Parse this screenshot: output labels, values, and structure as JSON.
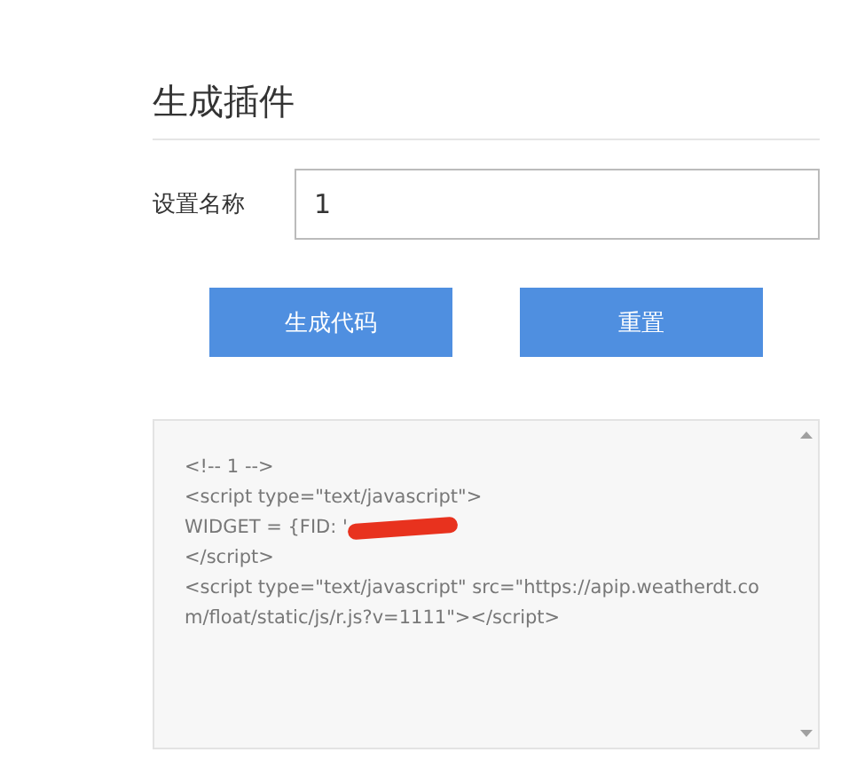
{
  "title": "生成插件",
  "form": {
    "label": "设置名称",
    "value": "1"
  },
  "buttons": [
    {
      "label": "生成代码"
    },
    {
      "label": "重置"
    }
  ],
  "code_lines": [
    {
      "text": "<!-- 1 -->",
      "redacted": false
    },
    {
      "text": "<script type=\"text/javascript\">",
      "redacted": false
    },
    {
      "text": "WIDGET = {FID: '",
      "redacted": true
    },
    {
      "text": "</script>",
      "redacted": false
    },
    {
      "text": "<script type=\"text/javascript\" src=\"https://apip.weatherdt.co",
      "redacted": false
    },
    {
      "text": "m/float/static/js/r.js?v=1111\"></script>",
      "redacted": false
    }
  ]
}
